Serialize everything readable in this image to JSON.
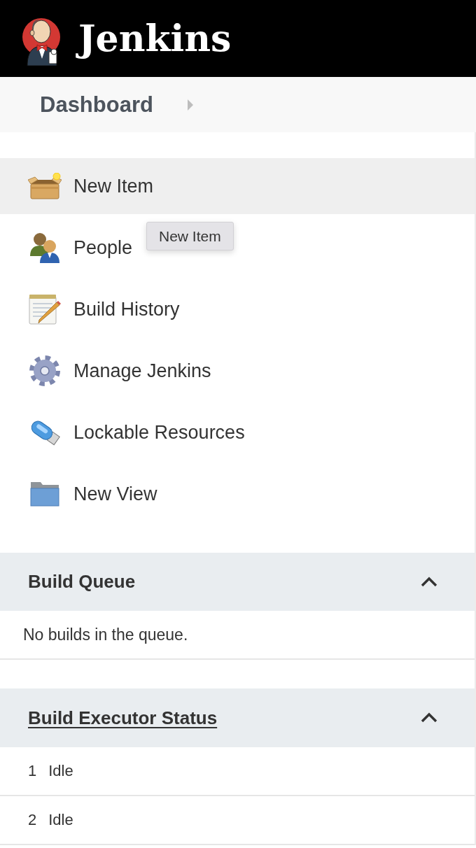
{
  "header": {
    "title": "Jenkins"
  },
  "breadcrumb": [
    {
      "label": "Dashboard"
    }
  ],
  "menu": [
    {
      "label": "New Item",
      "kind": "box",
      "hovered": true
    },
    {
      "label": "People",
      "kind": "people",
      "hovered": false
    },
    {
      "label": "Build History",
      "kind": "notepad",
      "hovered": false
    },
    {
      "label": "Manage Jenkins",
      "kind": "gear",
      "hovered": false
    },
    {
      "label": "Lockable Resources",
      "kind": "usb",
      "hovered": false
    },
    {
      "label": "New View",
      "kind": "folder",
      "hovered": false
    }
  ],
  "tooltip": {
    "text": "New Item"
  },
  "build_queue": {
    "title": "Build Queue",
    "expanded": true,
    "message": "No builds in the queue."
  },
  "executor_status": {
    "title": "Build Executor Status",
    "expanded": true,
    "executors": [
      {
        "number": "1",
        "status": "Idle"
      },
      {
        "number": "2",
        "status": "Idle"
      }
    ]
  }
}
